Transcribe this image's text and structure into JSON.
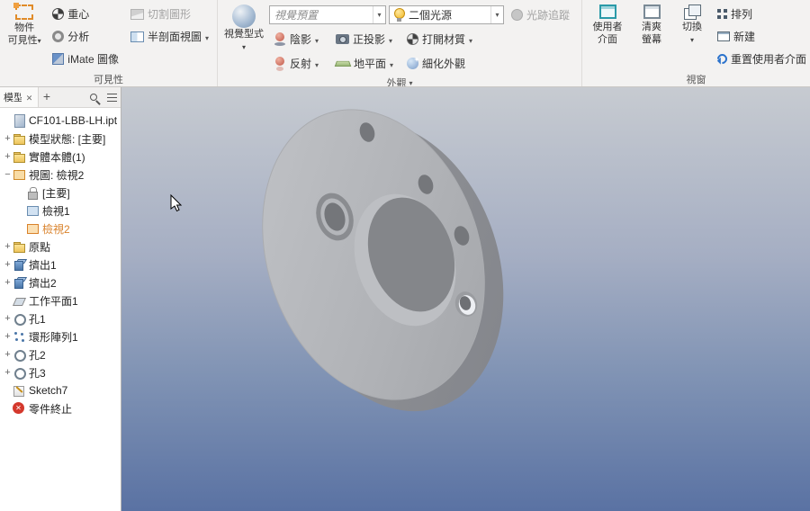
{
  "colors": {
    "highlight_orange": "#d9822b",
    "ribbon_bg": "#f3f2f1",
    "viewport_gradient_top": "#c7cbd1",
    "viewport_gradient_bottom": "#5a72a3",
    "part_gray": "#b0b2b6",
    "ui_icon_teal": "#2a9aa8",
    "reset_arrow_blue": "#2a72cc",
    "end_of_part_red": "#d4382c"
  },
  "icons": {
    "search": "magnifier",
    "menu": "hamburger",
    "close_tab": "✕",
    "add_tab": "+",
    "dropdown_caret": "▾",
    "reset_arrow": "↺",
    "end_of_part": "✕"
  },
  "ribbon": {
    "visibility": {
      "group_label": "可見性",
      "object_visibility_line1": "物件",
      "object_visibility_line2": "可見性",
      "center_of_gravity": "重心",
      "analysis": "分析",
      "imate_glyph": "iMate 圖像",
      "slice_graphics": "切割圖形",
      "half_section_view": "半剖面視圖"
    },
    "appearance": {
      "group_label": "外觀",
      "visual_style": "視覺型式",
      "visual_preset": "視覺預置",
      "shadows": "陰影",
      "reflections": "反射",
      "two_lights": "二個光源",
      "orthographic": "正投影",
      "ground_plane": "地平面",
      "textures_on": "打開材質",
      "refine_appearance": "細化外觀",
      "ray_tracing": "光跡追蹤"
    },
    "windows": {
      "group_label": "視窗",
      "user_interface_line1": "使用者",
      "user_interface_line2": "介面",
      "clean_screen_line1": "清爽",
      "clean_screen_line2": "螢幕",
      "switch_windows": "切換",
      "arrange": "排列",
      "new_window": "新建",
      "reset_ui": "重置使用者介面"
    }
  },
  "browser": {
    "tab_label": "模型",
    "tree": [
      {
        "label": "CF101-LBB-LH.ipt",
        "expander": ""
      },
      {
        "label": "模型狀態: [主要]",
        "expander": "+"
      },
      {
        "label": "實體本體(1)",
        "expander": "+"
      },
      {
        "label": "視圖: 檢視2",
        "expander": "−"
      },
      {
        "label": "[主要]",
        "expander": ""
      },
      {
        "label": "檢視1",
        "expander": ""
      },
      {
        "label": "檢視2",
        "expander": ""
      },
      {
        "label": "原點",
        "expander": "+"
      },
      {
        "label": "擠出1",
        "expander": "+"
      },
      {
        "label": "擠出2",
        "expander": "+"
      },
      {
        "label": "工作平面1",
        "expander": ""
      },
      {
        "label": "孔1",
        "expander": "+"
      },
      {
        "label": "環形陣列1",
        "expander": "+"
      },
      {
        "label": "孔2",
        "expander": "+"
      },
      {
        "label": "孔3",
        "expander": "+"
      },
      {
        "label": "Sketch7",
        "expander": ""
      },
      {
        "label": "零件終止",
        "expander": ""
      }
    ]
  }
}
